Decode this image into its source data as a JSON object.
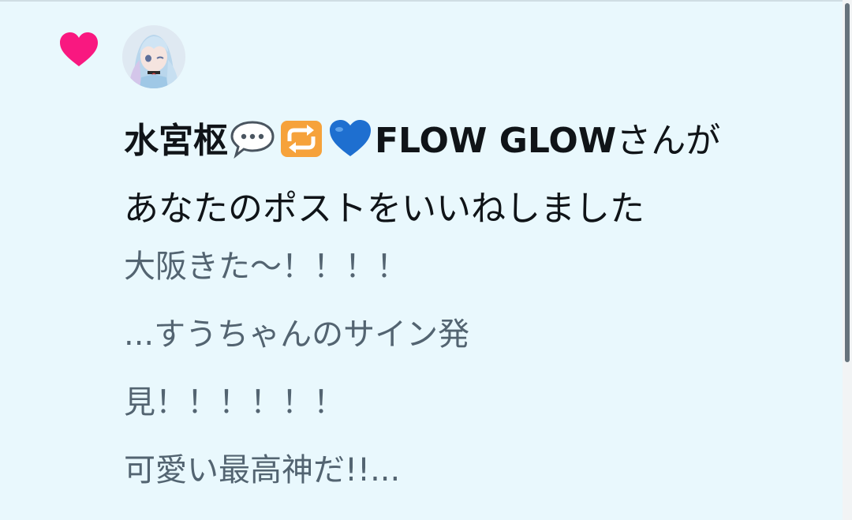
{
  "notification": {
    "type_icon": "heart-icon",
    "type_color": "#f91880",
    "avatar_icon": "user-avatar",
    "user_name": "水宮枢",
    "name_emojis": [
      "speech-balloon-icon",
      "repeat-icon",
      "blue-heart-icon"
    ],
    "group_name": "FLOW GLOW",
    "honorific": "さんが",
    "action_text": "あなたのポストをいいねしました",
    "post_lines": [
      "大阪きた〜！！！！",
      "...すうちゃんのサイン発",
      "見！！！！！！",
      "可愛い最高神だ!!..."
    ]
  },
  "colors": {
    "background": "#e9f8fd",
    "primary_text": "#101418",
    "secondary_text": "#536471",
    "like_pink": "#f91880"
  }
}
